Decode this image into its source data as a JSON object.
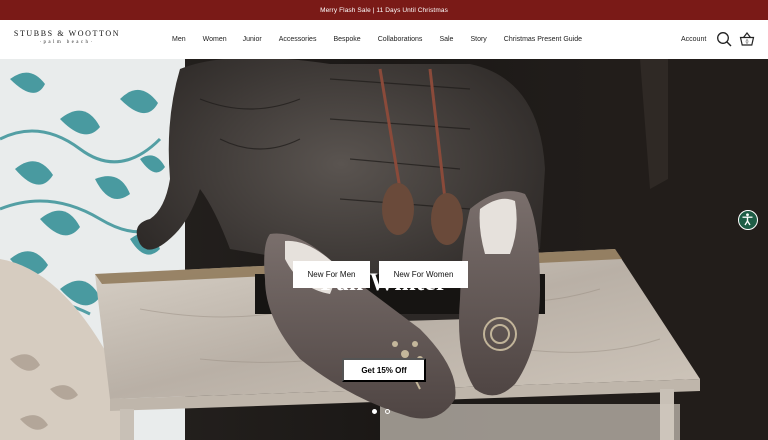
{
  "announcement": "Merry Flash Sale | 11 Days Until Christmas",
  "brand": {
    "name": "STUBBS & WOOTTON",
    "tagline": "·palm beach·"
  },
  "nav": [
    "Men",
    "Women",
    "Junior",
    "Accessories",
    "Bespoke",
    "Collaborations",
    "Sale",
    "Story",
    "Christmas Present Guide"
  ],
  "header": {
    "account": "Account",
    "cart_count": "0",
    "search_icon": "search-icon",
    "cart_icon": "basket-icon"
  },
  "hero": {
    "title": "Fall Winter",
    "cta_men": "New For Men",
    "cta_women": "New For Women",
    "slides": 2,
    "active_slide": 1
  },
  "promo": "Get 15% Off",
  "accessibility_icon": "accessibility-icon",
  "colors": {
    "announcement_bg": "#7a1a17",
    "accessibility_bg": "#1e5d46"
  }
}
